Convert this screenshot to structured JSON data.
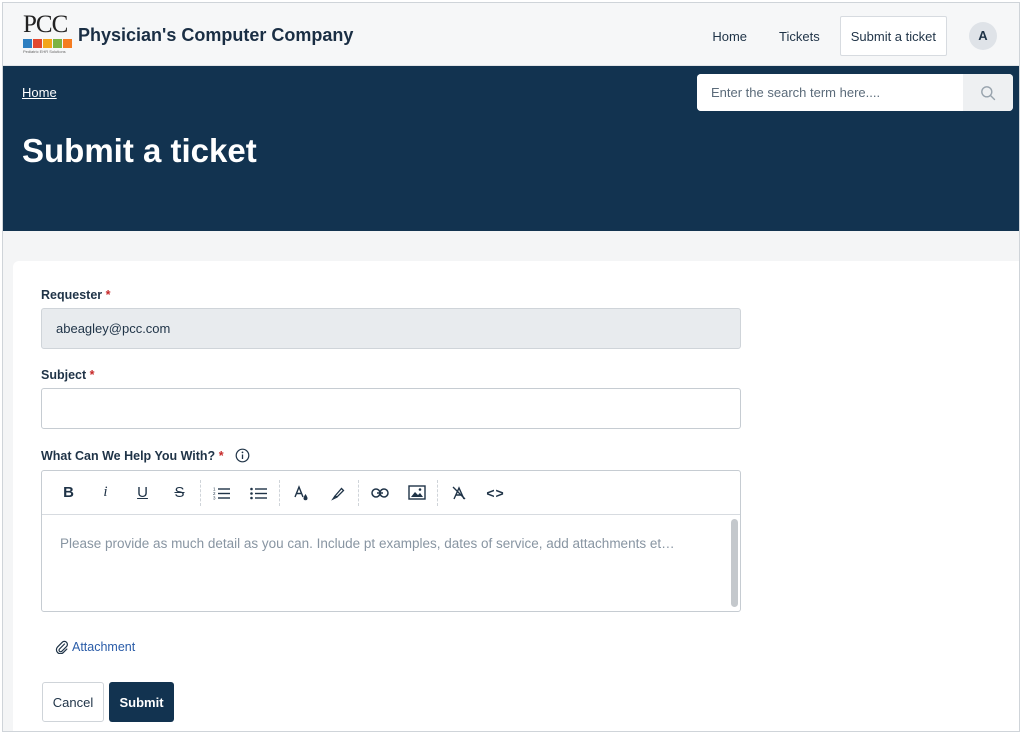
{
  "header": {
    "logo_text": "PCC",
    "logo_tagline": "Pediatric EHR Solutions",
    "logo_colors": [
      "#2e7fc1",
      "#e2492f",
      "#f2a51a",
      "#7cb342",
      "#f57c21"
    ],
    "company_name": "Physician's Computer Company",
    "nav": {
      "home": "Home",
      "tickets": "Tickets",
      "submit_ticket": "Submit a ticket"
    },
    "avatar_initial": "A"
  },
  "hero": {
    "breadcrumb": "Home",
    "title": "Submit a ticket",
    "search_placeholder": "Enter the search term here....",
    "background_color": "#123350"
  },
  "form": {
    "requester": {
      "label": "Requester",
      "required_mark": "*",
      "value": "abeagley@pcc.com"
    },
    "subject": {
      "label": "Subject",
      "required_mark": "*",
      "value": ""
    },
    "description": {
      "label": "What Can We Help You With?",
      "required_mark": "*",
      "placeholder": "Please provide as much detail as you can. Include pt examples, dates of service, add attachments et…",
      "toolbar": {
        "bold": "B",
        "italic": "i",
        "underline": "U",
        "strikethrough": "S",
        "code": "<>"
      }
    },
    "attachment_label": "Attachment",
    "cancel_label": "Cancel",
    "submit_label": "Submit"
  }
}
